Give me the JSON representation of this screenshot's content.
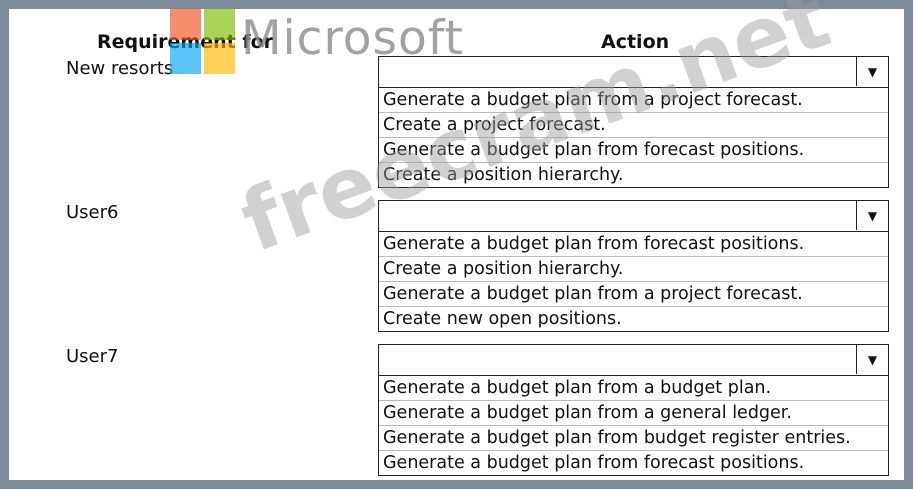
{
  "headers": {
    "requirement": "Requirement for",
    "action": "Action"
  },
  "rows": [
    {
      "label": "New resorts",
      "options": [
        "Generate a budget plan from a project forecast.",
        "Create a project forecast.",
        "Generate a budget plan from forecast positions.",
        "Create a position hierarchy."
      ]
    },
    {
      "label": "User6",
      "options": [
        "Generate a budget plan from forecast positions.",
        "Create a position hierarchy.",
        "Generate a budget plan from a project forecast.",
        "Create new open positions."
      ]
    },
    {
      "label": "User7",
      "options": [
        "Generate a budget plan from a budget plan.",
        "Generate a budget plan from a general ledger.",
        "Generate a budget plan from budget register entries.",
        "Generate a budget plan from forecast positions."
      ]
    }
  ],
  "dropdown_arrow": "▼",
  "logo": {
    "text": "Microsoft",
    "colors": [
      "#f25022",
      "#7fba00",
      "#00a4ef",
      "#ffb900"
    ]
  },
  "watermark": "freecram.net"
}
